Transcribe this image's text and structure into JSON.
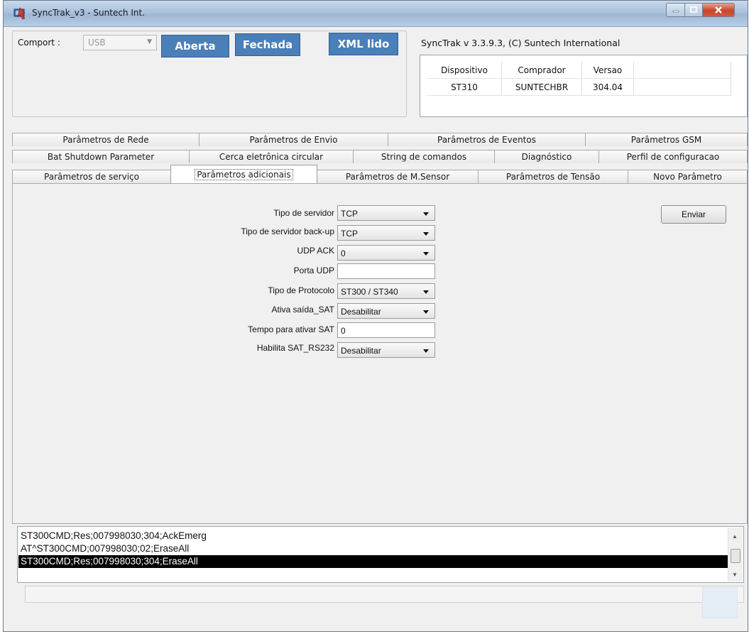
{
  "window": {
    "title": "SyncTrak_v3 - Suntech Int."
  },
  "top": {
    "comport_label": "Comport :",
    "comport_value": "USB",
    "aberta_label": "Aberta",
    "fechada_label": "Fechada",
    "xml_lido_label": "XML lido",
    "version_text": "SyncTrak v 3.3.9.3, (C) Suntech International"
  },
  "device_table": {
    "headers": [
      "Dispositivo",
      "Comprador",
      "Versao",
      ""
    ],
    "rows": [
      [
        "ST310",
        "SUNTECHBR",
        "304.04",
        ""
      ]
    ]
  },
  "tabs": {
    "row1": [
      "Parâmetros de Rede",
      "Parâmetros de Envio",
      "Parâmetros de Eventos",
      "Parâmetros GSM"
    ],
    "row2": [
      "Bat Shutdown Parameter",
      "Cerca eletrônica circular",
      "String de comandos",
      "Diagnóstico",
      "Perfil de configuracao"
    ],
    "row3": [
      "Parâmetros de serviço",
      "Parâmetros adicionais",
      "Parâmetros  de M.Sensor",
      "Parâmetros de Tensão",
      "Novo Parâmetro"
    ],
    "active": "Parâmetros adicionais"
  },
  "form": {
    "fields": [
      {
        "label": "Tipo de servidor",
        "value": "TCP"
      },
      {
        "label": "Tipo de servidor back-up",
        "value": "TCP"
      },
      {
        "label": "UDP ACK",
        "value": "0"
      },
      {
        "label": "Porta UDP",
        "value": ""
      },
      {
        "label": "Tipo de Protocolo",
        "value": "ST300 / ST340"
      },
      {
        "label": "Ativa saída_SAT",
        "value": "Desabilitar"
      },
      {
        "label": "Tempo para ativar SAT",
        "value": "0"
      },
      {
        "label": "Habilita SAT_RS232",
        "value": "Desabilitar"
      }
    ],
    "enviar_label": "Enviar"
  },
  "log": {
    "lines": [
      "ST300CMD;Res;007998030;304;AckEmerg",
      "AT^ST300CMD;007998030;02;EraseAll",
      "ST300CMD;Res;007998030;304;EraseAll"
    ],
    "selected_index": 2
  },
  "icons": {
    "app": "app-icon",
    "minimize": "minimize-icon",
    "maximize": "maximize-icon",
    "close": "close-icon"
  },
  "colors": {
    "accent_button": "#4a7fb8",
    "selected_row_bg": "#000000",
    "selected_row_fg": "#ffffff"
  }
}
